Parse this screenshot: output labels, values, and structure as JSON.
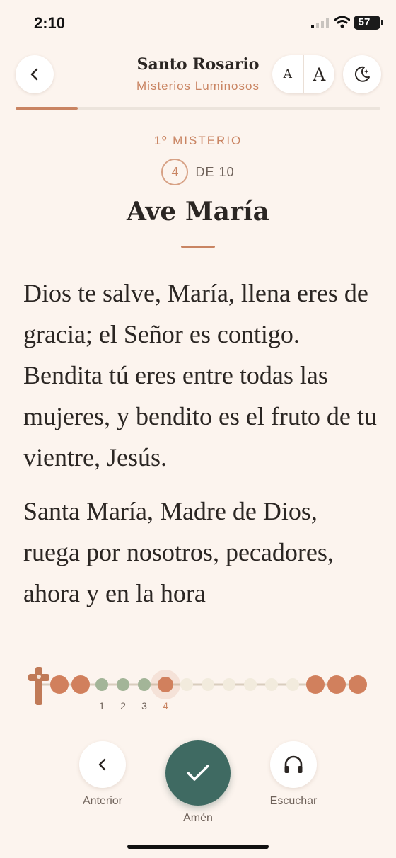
{
  "status_bar": {
    "time": "2:10",
    "battery": "57"
  },
  "header": {
    "title": "Santo Rosario",
    "subtitle": "Misterios Luminosos",
    "back_icon": "chevron-left-icon",
    "font_small_label": "A",
    "font_large_label": "A",
    "theme_icon": "moon-stars-icon"
  },
  "progress": {
    "fraction": 0.17
  },
  "prayer": {
    "mystery_label": "1º MISTERIO",
    "current": "4",
    "total_label": "DE 10",
    "title": "Ave María",
    "paragraphs": [
      "Dios te salve, María, llena eres de gracia; el Señor es contigo. Bendita tú eres entre todas las mujeres, y bendito es el fruto de tu vientre, Jesús.",
      "Santa María, Madre de Dios, ruega por nosotros, pecadores, ahora y en la hora"
    ]
  },
  "rosary": {
    "bead_labels": [
      "1",
      "2",
      "3",
      "4"
    ],
    "current_bead": 4,
    "colors": {
      "large": "#d1805d",
      "done": "#a3b598",
      "current": "#d1805d",
      "pending": "#f2ebdd",
      "cord": "#d9cdbd"
    }
  },
  "bottom_nav": {
    "prev_label": "Anterior",
    "amen_label": "Amén",
    "listen_label": "Escuchar",
    "prev_icon": "chevron-left-icon",
    "amen_icon": "checkmark-icon",
    "listen_icon": "headphones-icon"
  },
  "colors": {
    "accent": "#c98462",
    "primary": "#3f6a62",
    "background": "#fcf4ee"
  }
}
